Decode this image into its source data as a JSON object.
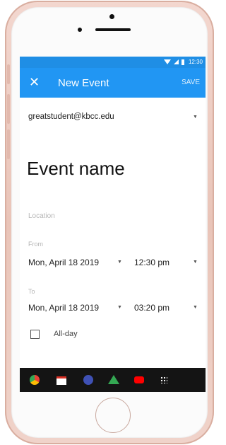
{
  "status_bar": {
    "time": "12:30"
  },
  "app_bar": {
    "close_icon": "close-icon",
    "title": "New Event",
    "save_label": "SAVE"
  },
  "form": {
    "account": "greatstudent@kbcc.edu",
    "event_name": "Event name",
    "location_placeholder": "Location",
    "from_label": "From",
    "from_date": "Mon, April 18 2019",
    "from_time": "12:30 pm",
    "to_label": "To",
    "to_date": "Mon, April 18 2019",
    "to_time": "03:20 pm",
    "all_day_label": "All-day"
  },
  "nav_bar": {
    "icons": [
      "chrome-icon",
      "gmail-icon",
      "browser-icon",
      "drive-icon",
      "youtube-icon",
      "app-grid-icon"
    ]
  },
  "colors": {
    "status_bar": "#1f8ee5",
    "app_bar": "#2196f3",
    "nav_bar": "#141414"
  }
}
